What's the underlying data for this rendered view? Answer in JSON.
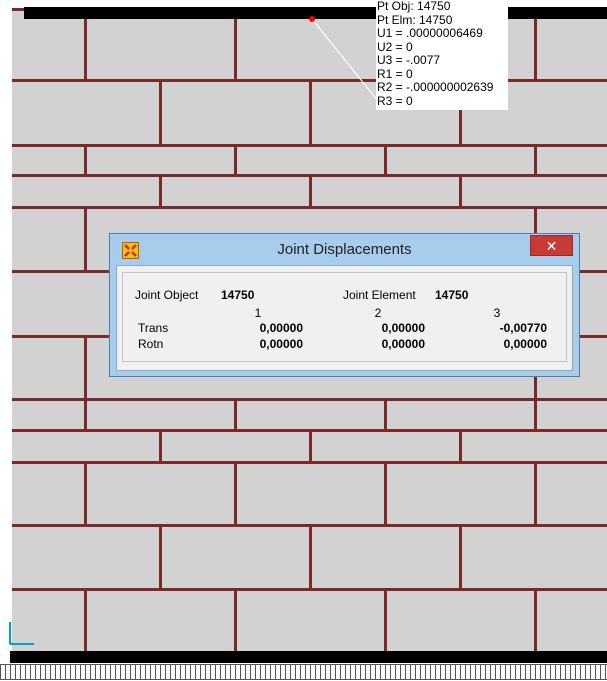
{
  "pick_info": {
    "lines": [
      "Pt Obj: 14750",
      "Pt Elm: 14750",
      "U1 = .00000006469",
      "U2 = 0",
      "U3 = -.0077",
      "R1 = 0",
      "R2 = -.000000002639",
      "R3 = 0"
    ]
  },
  "dialog": {
    "title": "Joint Displacements",
    "close_glyph": "✕",
    "joint_object_label": "Joint Object",
    "joint_object_value": "14750",
    "joint_element_label": "Joint Element",
    "joint_element_value": "14750",
    "columns": [
      "1",
      "2",
      "3"
    ],
    "rows": [
      {
        "label": "Trans",
        "values": [
          "0,00000",
          "0,00000",
          "-0,00770"
        ]
      },
      {
        "label": "Rotn",
        "values": [
          "0,00000",
          "0,00000",
          "0,00000"
        ]
      }
    ]
  },
  "colors": {
    "canvas": "#d2d2d2",
    "mortar": "#7b2a2a",
    "pick_point": "#ff0000",
    "dialog_frame": "#a7ccec",
    "close_button": "#c73a35"
  },
  "icons": {
    "app_icon": "sap-app-icon",
    "close": "close-icon",
    "axis": "axis-triad-icon"
  }
}
